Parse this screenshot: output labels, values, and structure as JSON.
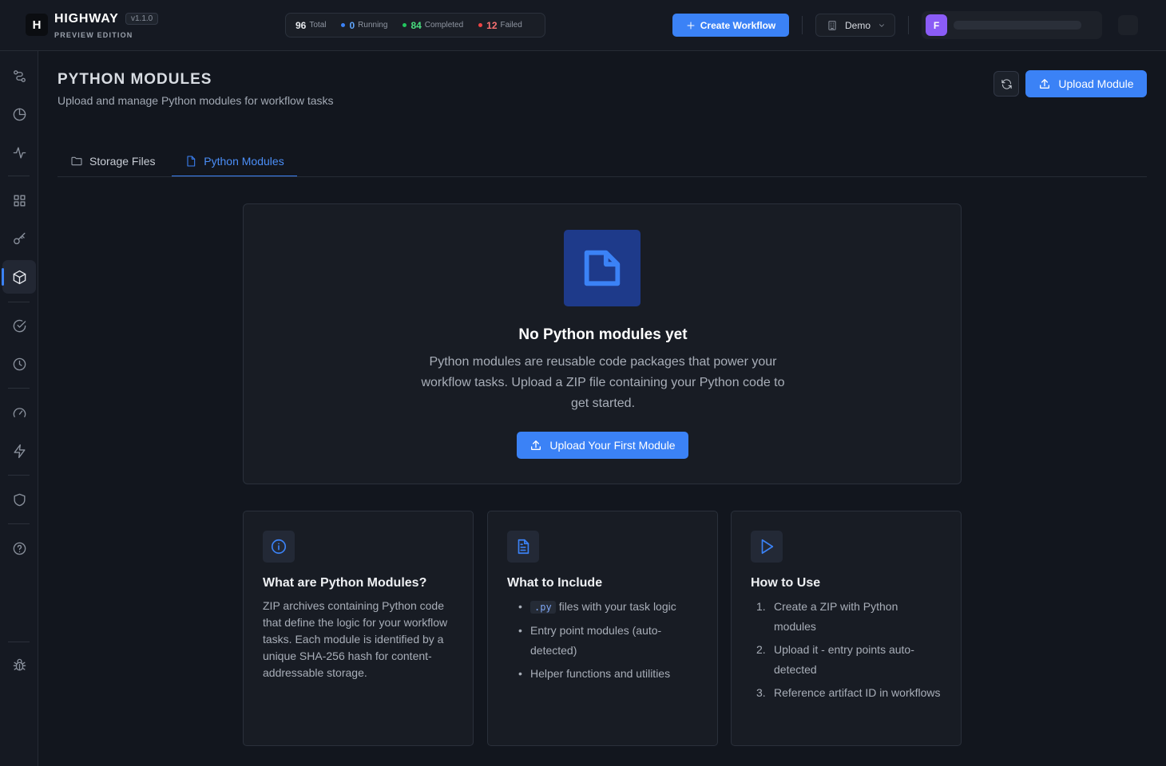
{
  "app": {
    "logo_letter": "H",
    "name": "HIGHWAY",
    "version": "v1.1.0",
    "edition": "PREVIEW EDITION"
  },
  "stats": {
    "total": {
      "count": "96",
      "label": "Total"
    },
    "running": {
      "count": "0",
      "label": "Running"
    },
    "completed": {
      "count": "84",
      "label": "Completed"
    },
    "failed": {
      "count": "12",
      "label": "Failed"
    }
  },
  "toolbar": {
    "create_label": "Create Workflow",
    "org_selected": "Demo",
    "user_initial": "F"
  },
  "sidebar": {
    "icons": [
      "workflow-icon",
      "pie-chart-icon",
      "activity-icon",
      "grid-icon",
      "key-icon",
      "package-icon",
      "check-circle-icon",
      "clock-icon",
      "gauge-icon",
      "zap-icon",
      "shield-icon",
      "help-icon",
      "bug-icon"
    ],
    "active": "package-icon"
  },
  "header": {
    "title": "PYTHON MODULES",
    "subtitle": "Upload and manage Python modules for workflow tasks",
    "upload_label": "Upload Module"
  },
  "tabs": [
    {
      "label": "Storage Files",
      "active": false
    },
    {
      "label": "Python Modules",
      "active": true
    }
  ],
  "empty_state": {
    "title": "No Python modules yet",
    "description": "Python modules are reusable code packages that power your workflow tasks. Upload a ZIP file containing your Python code to get started.",
    "cta_label": "Upload Your First Module"
  },
  "cards": {
    "about": {
      "title": "What are Python Modules?",
      "body": "ZIP archives containing Python code that define the logic for your workflow tasks. Each module is identified by a unique SHA-256 hash for content-addressable storage."
    },
    "include": {
      "title": "What to Include",
      "code": ".py",
      "items": [
        "files with your task logic",
        "Entry point modules (auto-detected)",
        "Helper functions and utilities"
      ]
    },
    "howto": {
      "title": "How to Use",
      "items": [
        "Create a ZIP with Python modules",
        "Upload it - entry points auto-detected",
        "Reference artifact ID in workflows"
      ]
    }
  },
  "colors": {
    "accent": "#3b82f6",
    "running": "#3b82f6",
    "completed": "#22c55e",
    "failed": "#ef4444",
    "avatar": "#8b5cf6"
  }
}
